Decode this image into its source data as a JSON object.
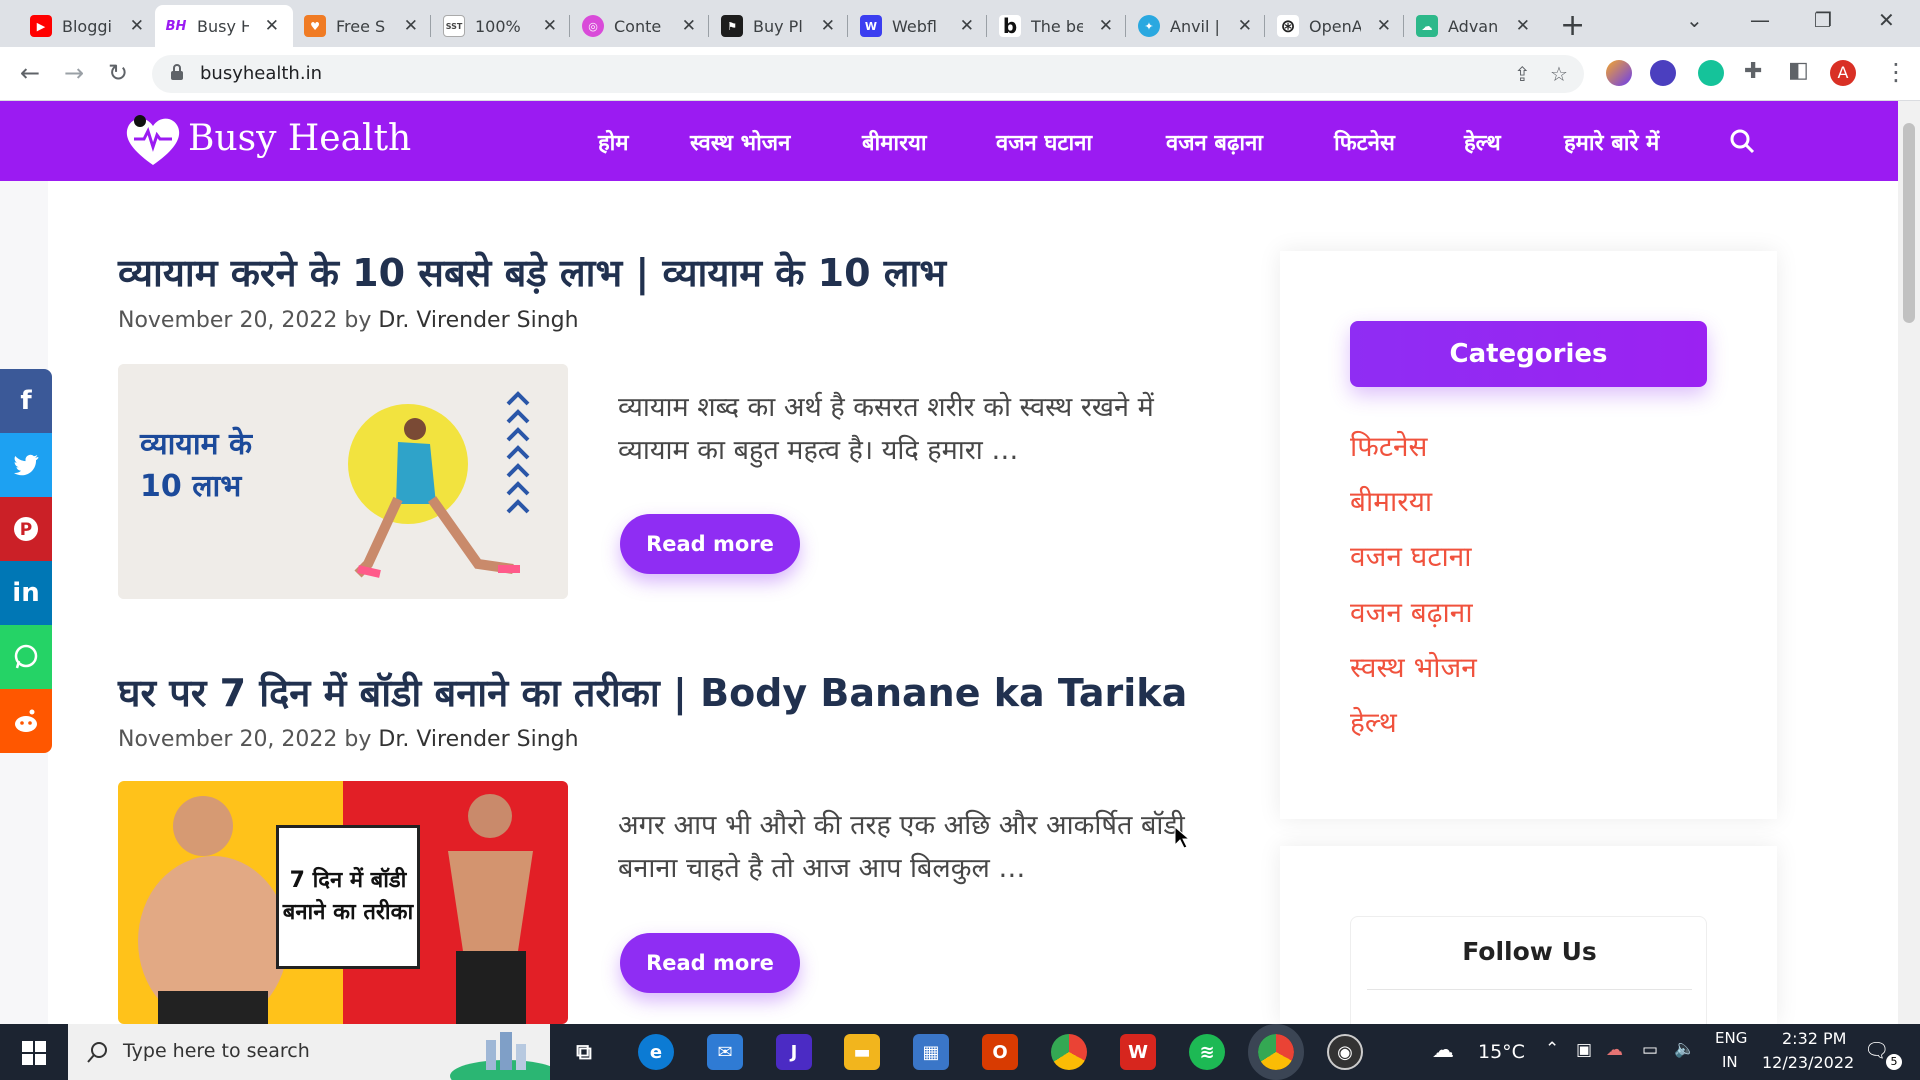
{
  "browser": {
    "tabs": [
      {
        "label": "Bloggi",
        "color": "#ff0000",
        "glyph": "▶"
      },
      {
        "label": "Busy H",
        "color": "#9b1bf2",
        "glyph": "BH",
        "active": true
      },
      {
        "label": "Free S",
        "color": "#f07b24",
        "glyph": "♥"
      },
      {
        "label": "100% ",
        "color": "#ffffff",
        "glyph": "SST"
      },
      {
        "label": "Conte",
        "color": "#d94bd9",
        "glyph": "◎"
      },
      {
        "label": "Buy Pl",
        "color": "#1d1d1d",
        "glyph": "⚑"
      },
      {
        "label": "Webfl",
        "color": "#3b3ef0",
        "glyph": "W"
      },
      {
        "label": "The be",
        "color": "#ffffff",
        "glyph": "b"
      },
      {
        "label": "Anvil |",
        "color": "#2aa8e0",
        "glyph": "✦"
      },
      {
        "label": "OpenA",
        "color": "#ffffff",
        "glyph": "⊛"
      },
      {
        "label": "Advan",
        "color": "#2db88a",
        "glyph": "☁"
      }
    ],
    "new_tab": "+",
    "url": "busyhealth.in"
  },
  "site": {
    "logo_text": "Busy Health",
    "menu": [
      "होम",
      "स्वस्थ भोजन",
      "बीमारया",
      "वजन घटाना",
      "वजन बढ़ाना",
      "फिटनेस",
      "हेल्थ",
      "हमारे बारे में"
    ],
    "brand_color": "#9b1bf2"
  },
  "posts": [
    {
      "title": "व्यायाम करने के 10 सबसे बड़े लाभ | व्यायाम के 10 लाभ",
      "date": "November 20, 2022",
      "by": "by",
      "author": "Dr. Virender Singh",
      "thumb_text": "व्यायाम के 10 लाभ",
      "excerpt": "व्यायाम शब्द का अर्थ है कसरत शरीर को स्वस्थ रखने में व्यायाम का बहुत महत्व है। यदि हमारा …",
      "read_more": "Read more"
    },
    {
      "title": "घर पर 7 दिन में बॉडी बनाने का तरीका | Body Banane ka Tarika",
      "date": "November 20, 2022",
      "by": "by",
      "author": "Dr. Virender Singh",
      "thumb_text": "7 दिन में बॉडी बनाने का तरीका",
      "excerpt": "अगर आप भी औरो की तरह एक अछि और आकर्षित बॉडी बनाना चाहते है तो आज आप बिलकुल …",
      "read_more": "Read more"
    }
  ],
  "sidebar": {
    "categories_title": "Categories",
    "categories": [
      "फिटनेस",
      "बीमारया",
      "वजन घटाना",
      "वजन बढ़ाना",
      "स्वस्थ भोजन",
      "हेल्थ"
    ],
    "follow_title": "Follow Us"
  },
  "share": [
    {
      "name": "facebook",
      "glyph": "f",
      "color": "#3b5998"
    },
    {
      "name": "twitter",
      "glyph": "🐦",
      "color": "#1da1f2"
    },
    {
      "name": "pinterest",
      "glyph": "P",
      "color": "#cb2027"
    },
    {
      "name": "linkedin",
      "glyph": "in",
      "color": "#0077b5"
    },
    {
      "name": "whatsapp",
      "glyph": "✆",
      "color": "#25d366"
    },
    {
      "name": "reddit",
      "glyph": "👽",
      "color": "#ff5700"
    }
  ],
  "taskbar": {
    "search_placeholder": "Type here to search",
    "temperature": "15°C",
    "lang_top": "ENG",
    "lang_bottom": "IN",
    "time": "2:32 PM",
    "date": "12/23/2022",
    "notifications": "5"
  }
}
